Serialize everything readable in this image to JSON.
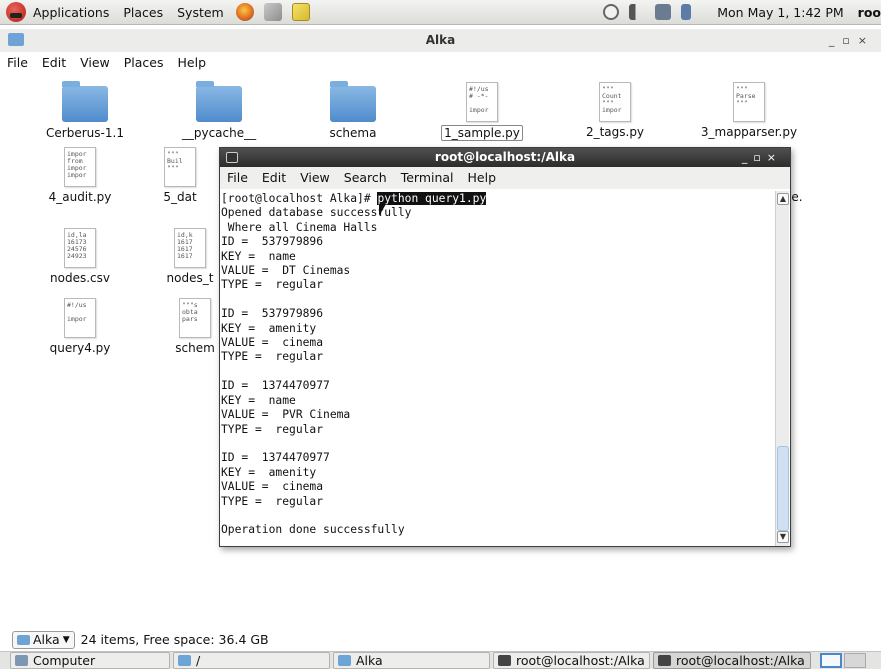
{
  "top_panel": {
    "menus": [
      "Applications",
      "Places",
      "System"
    ],
    "clock": "Mon May  1,  1:42 PM",
    "user": "roo",
    "launcher_icons": [
      "firefox-icon",
      "tools-icon",
      "editor-icon"
    ],
    "tray_icons": [
      "update-icon",
      "volume-icon",
      "network-icon",
      "battery-icon"
    ]
  },
  "file_manager": {
    "title": "Alka",
    "menu": [
      "File",
      "Edit",
      "View",
      "Places",
      "Help"
    ],
    "items": [
      {
        "name": "Cerberus-1.1",
        "type": "folder"
      },
      {
        "name": "__pycache__",
        "type": "folder"
      },
      {
        "name": "schema",
        "type": "folder"
      },
      {
        "name": "1_sample.py",
        "type": "file",
        "preview": "#!/us\n# -*-\n\nimpor"
      },
      {
        "name": "2_tags.py",
        "type": "file",
        "preview": "\"\"\"\nCount\n\"\"\"\nimpor"
      },
      {
        "name": "3_mapparser.py",
        "type": "file",
        "preview": "\"\"\"\nParse\n\"\"\""
      },
      {
        "name": "4_audit.py",
        "type": "file",
        "preview": "impor\nfrom\nimpor\nimpor"
      },
      {
        "name": "5_dat",
        "type": "file",
        "preview": "\"\"\"\nBuil\n\"\"\""
      },
      {
        "name": "nodes.csv",
        "type": "file",
        "preview": "id,la\n16173\n24576\n24923"
      },
      {
        "name": "nodes_t",
        "type": "file",
        "preview": "id,k\n1617\n1617\n1617"
      },
      {
        "name": "query4.py",
        "type": "file",
        "preview": "#!/us\n\nimpor"
      },
      {
        "name": "schem",
        "type": "file",
        "preview": "\"\"\"s\nobta\npars"
      }
    ],
    "right_partial": "le.",
    "status": {
      "location": "Alka",
      "info": "24 items, Free space: 36.4 GB"
    }
  },
  "terminal": {
    "title": "root@localhost:/Alka",
    "menu": [
      "File",
      "Edit",
      "View",
      "Search",
      "Terminal",
      "Help"
    ],
    "prompt": "[root@localhost Alka]# ",
    "command": "python query1.py",
    "output": "Opened database successfully\n Where all Cinema Halls\nID =  537979896\nKEY =  name\nVALUE =  DT Cinemas\nTYPE =  regular\n\nID =  537979896\nKEY =  amenity\nVALUE =  cinema\nTYPE =  regular\n\nID =  1374470977\nKEY =  name\nVALUE =  PVR Cinema\nTYPE =  regular\n\nID =  1374470977\nKEY =  amenity\nVALUE =  cinema\nTYPE =  regular\n\nOperation done successfully"
  },
  "taskbar": {
    "tasks": [
      {
        "label": "Computer",
        "icon": "computer-icon",
        "color": "#7d96b3"
      },
      {
        "label": "/",
        "icon": "folder-icon",
        "color": "#6ea3d6"
      },
      {
        "label": "Alka",
        "icon": "folder-icon",
        "color": "#6ea3d6"
      },
      {
        "label": "root@localhost:/Alka",
        "icon": "terminal-icon",
        "color": "#444444"
      },
      {
        "label": "root@localhost:/Alka",
        "icon": "terminal-icon",
        "color": "#444444"
      }
    ]
  },
  "colors": {
    "terminal_titlebar": "#3a3a3a",
    "folder": "#6ea3d6",
    "selection": "#111111"
  }
}
